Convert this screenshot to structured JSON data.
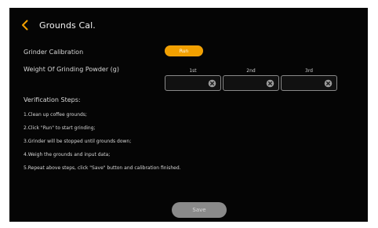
{
  "header": {
    "back_icon": "chevron-left-icon",
    "title": "Grounds Cal."
  },
  "grinder": {
    "label": "Grinder Calibration",
    "run_button_label": "Run",
    "run_button_color": "#F2A000"
  },
  "weights": {
    "label": "Weight Of Grinding Powder (g)",
    "columns": [
      {
        "heading": "1st",
        "value": "",
        "clear_icon": "clear-icon"
      },
      {
        "heading": "2nd",
        "value": "",
        "clear_icon": "clear-icon"
      },
      {
        "heading": "3rd",
        "value": "",
        "clear_icon": "clear-icon"
      }
    ]
  },
  "verification": {
    "title": "Verification Steps:",
    "steps": [
      "1.Clean up coffee grounds;",
      "2.Click \"Run\" to start grinding;",
      "3.Grinder will be stopped until grounds down;",
      "4.Weigh the grounds and input data;",
      "5.Repeat above steps, click \"Save\" button and calibration finished."
    ]
  },
  "footer": {
    "save_label": "Save",
    "save_color": "#8A8A8A"
  },
  "colors": {
    "background": "#050505",
    "text": "#D8D8D8",
    "accent": "#F2A000"
  }
}
